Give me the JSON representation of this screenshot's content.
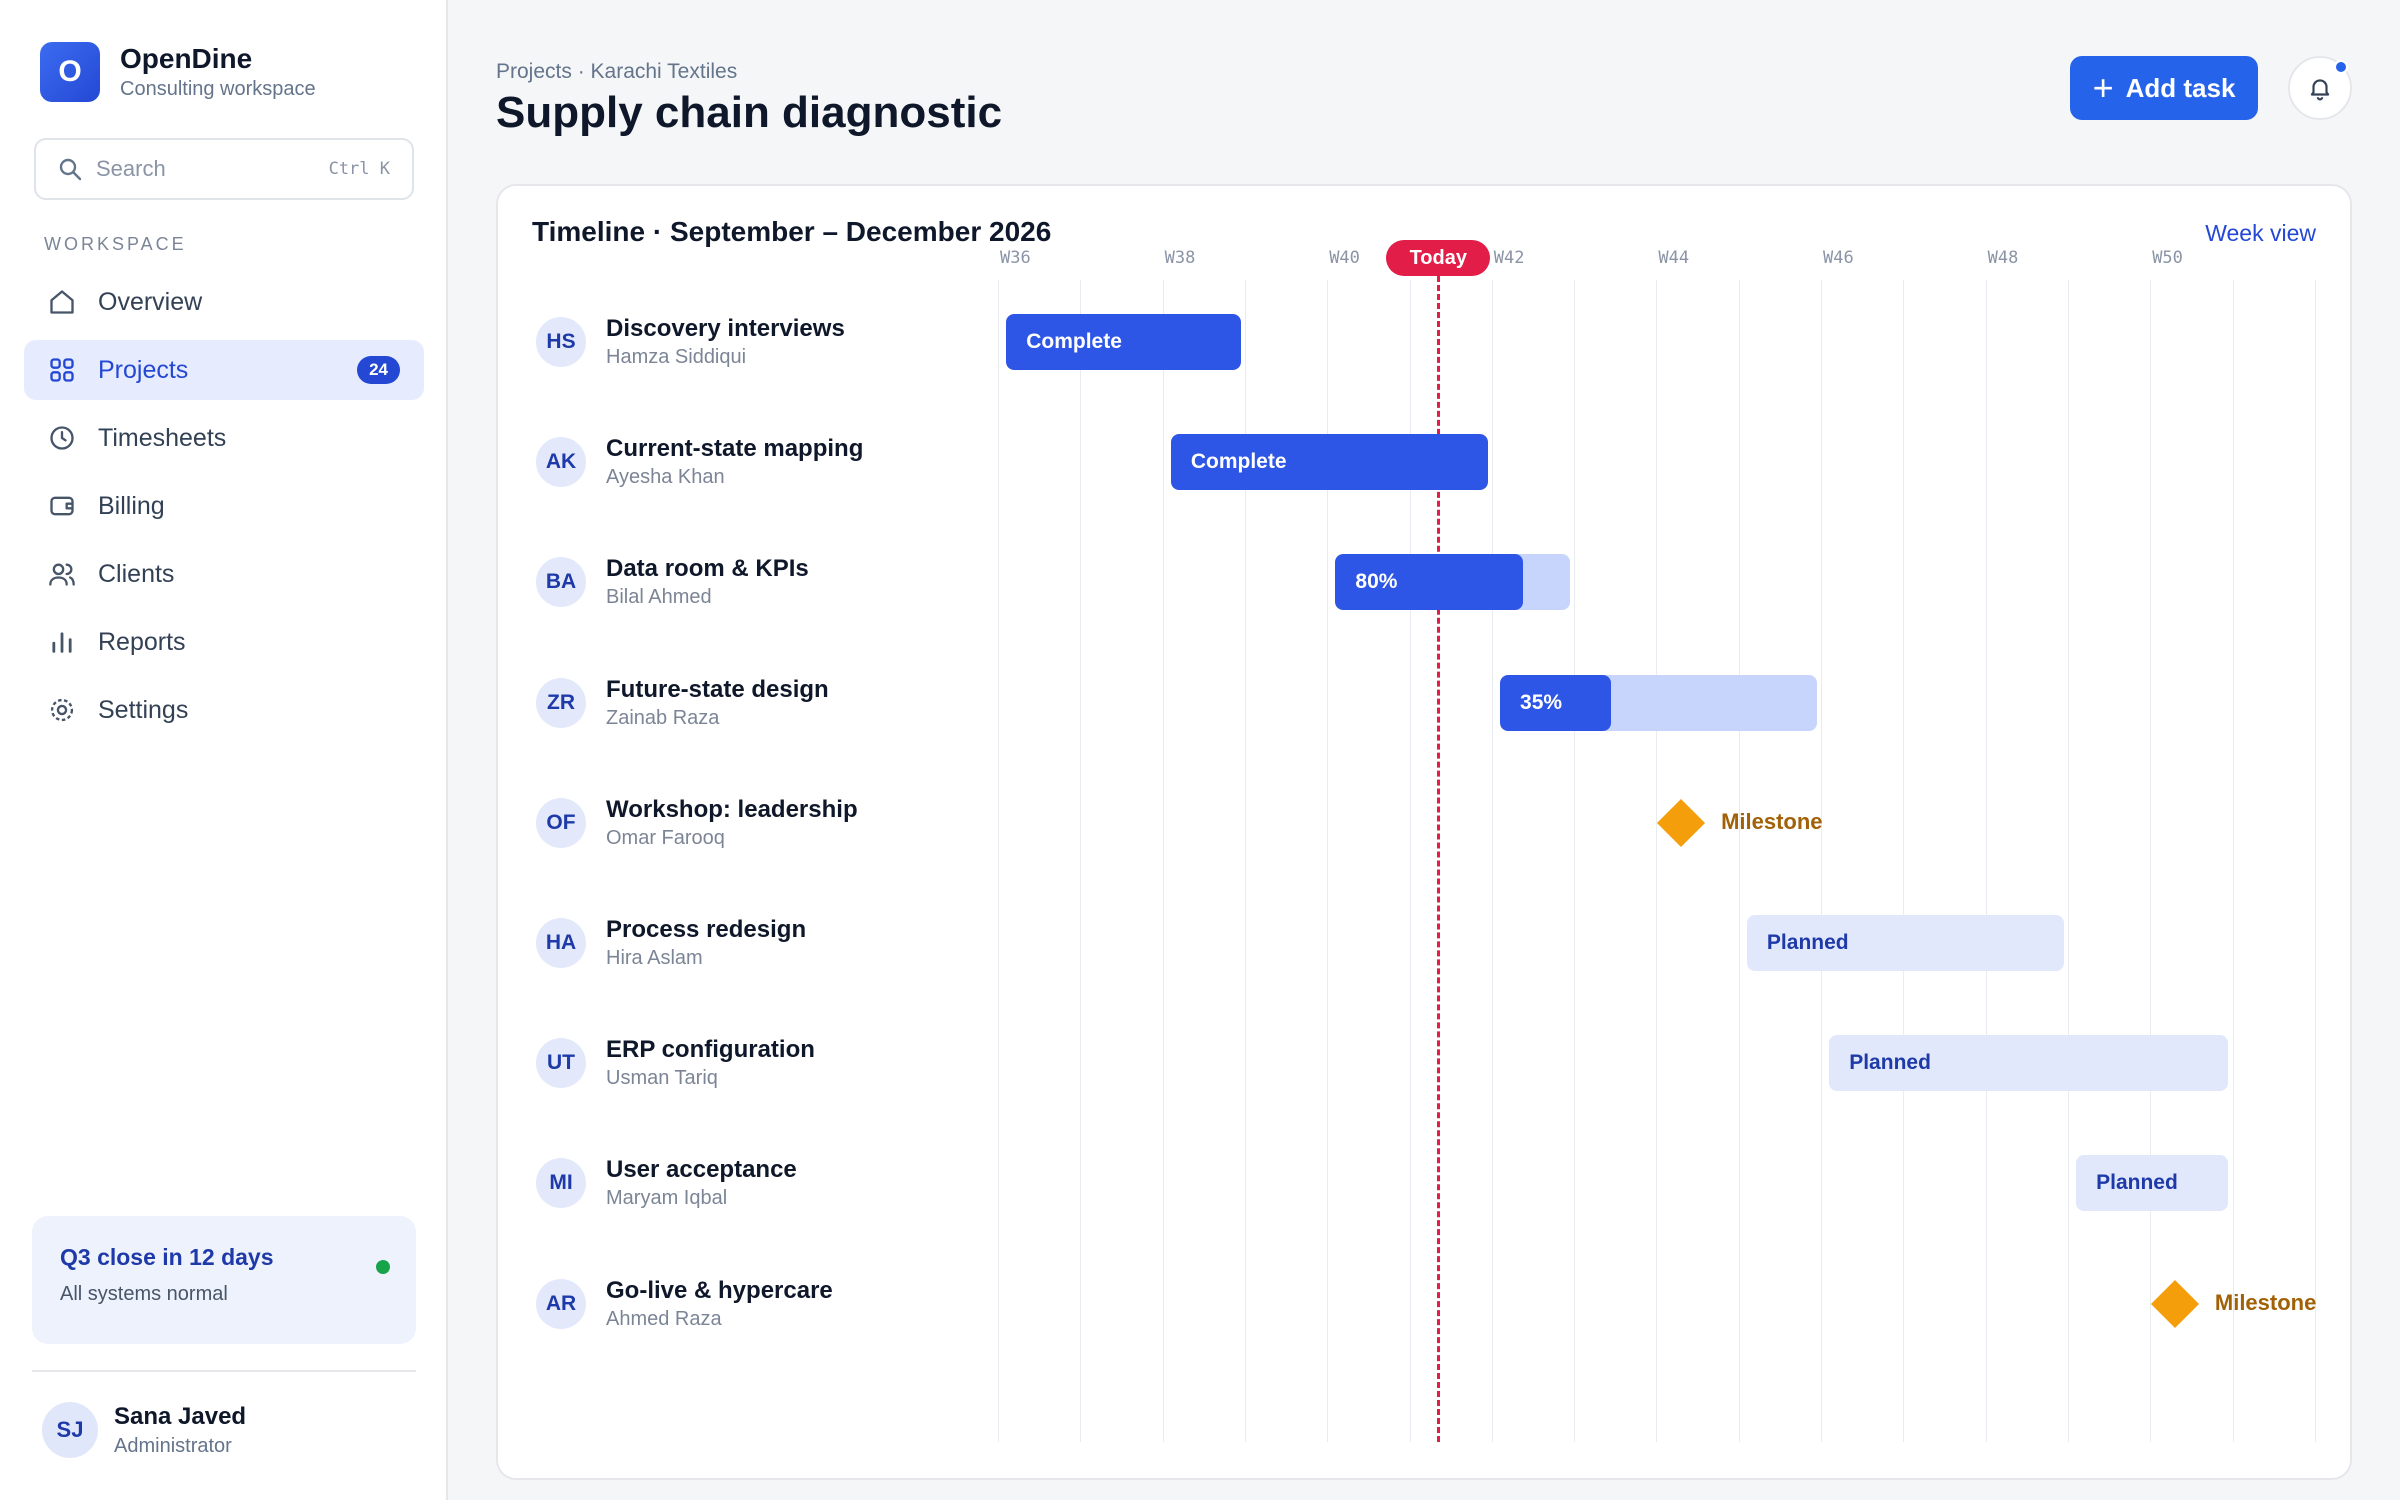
{
  "brand": {
    "logo_letter": "O",
    "name": "OpenDine",
    "subtitle": "Consulting workspace"
  },
  "search": {
    "placeholder": "Search",
    "shortcut": "Ctrl K"
  },
  "sidebar": {
    "section_label": "WORKSPACE",
    "items": [
      {
        "label": "Overview",
        "icon": "home-icon"
      },
      {
        "label": "Projects",
        "icon": "grid-icon",
        "badge": "24",
        "active": true
      },
      {
        "label": "Timesheets",
        "icon": "clock-icon"
      },
      {
        "label": "Billing",
        "icon": "wallet-icon"
      },
      {
        "label": "Clients",
        "icon": "users-icon"
      },
      {
        "label": "Reports",
        "icon": "bar-chart-icon"
      },
      {
        "label": "Settings",
        "icon": "gear-icon"
      }
    ],
    "status": {
      "title": "Q3 close in 12 days",
      "subtitle": "All systems normal",
      "dot_color": "#16a34a"
    },
    "user": {
      "initials": "SJ",
      "name": "Sana Javed",
      "role": "Administrator"
    }
  },
  "header": {
    "breadcrumb": "Projects · Karachi Textiles",
    "title": "Supply chain diagnostic",
    "add_button": "Add task",
    "accent": "#2563eb"
  },
  "timeline": {
    "title": "Timeline · September – December 2026",
    "view_link": "Week view",
    "today_label": "Today",
    "week_labels": [
      "W36",
      "W38",
      "W40",
      "W42",
      "W44",
      "W46",
      "W48",
      "W50"
    ],
    "tasks": [
      {
        "initials": "HS",
        "name": "Discovery interviews",
        "owner": "Hamza Siddiqui",
        "kind": "bar",
        "start_week": 36.1,
        "end_week": 38.95,
        "progress": 1.0,
        "label": "Complete"
      },
      {
        "initials": "AK",
        "name": "Current-state mapping",
        "owner": "Ayesha Khan",
        "kind": "bar",
        "start_week": 38.1,
        "end_week": 41.95,
        "progress": 1.0,
        "label": "Complete"
      },
      {
        "initials": "BA",
        "name": "Data room & KPIs",
        "owner": "Bilal Ahmed",
        "kind": "bar",
        "start_week": 40.1,
        "end_week": 42.95,
        "progress": 0.8,
        "label": "80%"
      },
      {
        "initials": "ZR",
        "name": "Future-state design",
        "owner": "Zainab Raza",
        "kind": "bar",
        "start_week": 42.1,
        "end_week": 45.95,
        "progress": 0.35,
        "label": "35%"
      },
      {
        "initials": "OF",
        "name": "Workshop: leadership",
        "owner": "Omar Farooq",
        "kind": "milestone",
        "week": 44.3,
        "label": "Milestone"
      },
      {
        "initials": "HA",
        "name": "Process redesign",
        "owner": "Hira Aslam",
        "kind": "bar",
        "start_week": 45.1,
        "end_week": 48.95,
        "progress": 0,
        "label": "Planned"
      },
      {
        "initials": "UT",
        "name": "ERP configuration",
        "owner": "Usman Tariq",
        "kind": "bar",
        "start_week": 46.1,
        "end_week": 50.95,
        "progress": 0,
        "label": "Planned"
      },
      {
        "initials": "MI",
        "name": "User acceptance",
        "owner": "Maryam Iqbal",
        "kind": "bar",
        "start_week": 49.1,
        "end_week": 50.95,
        "progress": 0,
        "label": "Planned"
      },
      {
        "initials": "AR",
        "name": "Go-live & hypercare",
        "owner": "Ahmed Raza",
        "kind": "milestone",
        "week": 50.3,
        "label": "Milestone"
      }
    ],
    "today_week": 41.35,
    "colors": {
      "done": "#2d55e6",
      "remaining": "#c7d4fb",
      "planned": "#e2e8fc",
      "milestone": "#f59e0b",
      "today": "#e11d48"
    }
  }
}
